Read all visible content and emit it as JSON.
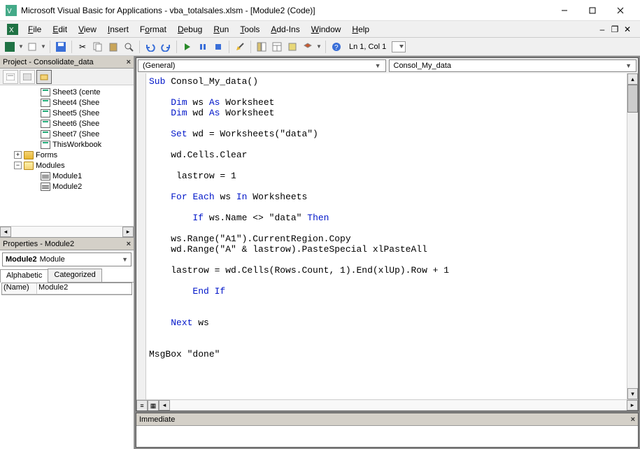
{
  "title": "Microsoft Visual Basic for Applications - vba_totalsales.xlsm - [Module2 (Code)]",
  "menu": {
    "file": "File",
    "edit": "Edit",
    "view": "View",
    "insert": "Insert",
    "format": "Format",
    "debug": "Debug",
    "run": "Run",
    "tools": "Tools",
    "addins": "Add-Ins",
    "window": "Window",
    "help": "Help"
  },
  "status_cursor": "Ln 1, Col 1",
  "project_panel": {
    "title": "Project - Consolidate_data",
    "tree": {
      "sheet3": "Sheet3 (cente",
      "sheet4": "Sheet4 (Shee",
      "sheet5": "Sheet5 (Shee",
      "sheet6": "Sheet6 (Shee",
      "sheet7": "Sheet7 (Shee",
      "thiswb": "ThisWorkbook",
      "forms": "Forms",
      "modules": "Modules",
      "module1": "Module1",
      "module2": "Module2"
    }
  },
  "properties_panel": {
    "title": "Properties - Module2",
    "combo_bold": "Module2",
    "combo_rest": "Module",
    "tab_alpha": "Alphabetic",
    "tab_cat": "Categorized",
    "row_name": "(Name)",
    "row_val": "Module2"
  },
  "code_combos": {
    "left": "(General)",
    "right": "Consol_My_data"
  },
  "code_tokens": {
    "sub": "Sub",
    "dim": "Dim",
    "as": "As",
    "set": "Set",
    "for": "For",
    "each": "Each",
    "in": "In",
    "if": "If",
    "then": "Then",
    "endif": "End If",
    "next": "Next",
    "proc_name": " Consol_My_data()",
    "ws_decl": " ws ",
    "wd_decl": " wd ",
    "worksheet": " Worksheet",
    "set_line": " wd = Worksheets(\"data\")",
    "clear_line": "wd.Cells.Clear",
    "lastrow_line": " lastrow = 1",
    "worksheets": " Worksheets",
    "if_cond": " ws.Name <> \"data\" ",
    "copy_line": "ws.Range(\"A1\").CurrentRegion.Copy",
    "paste_line": "wd.Range(\"A\" & lastrow).PasteSpecial xlPasteAll",
    "lastrow_upd": "lastrow = wd.Cells(Rows.Count, 1).End(xlUp).Row + 1",
    "next_var": " ws",
    "msgbox": "MsgBox \"done\""
  },
  "immediate_title": "Immediate"
}
